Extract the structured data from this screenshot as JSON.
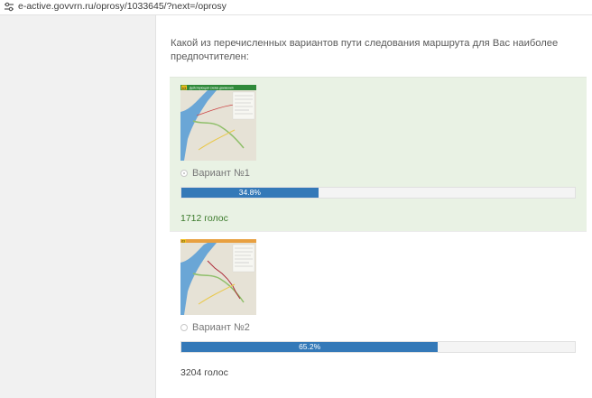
{
  "browser": {
    "url": "e-active.govvrn.ru/oprosy/1033645/?next=/oprosy",
    "url_icon": "tune-icon"
  },
  "poll": {
    "question": "Какой из перечисленных вариантов пути следования маршрута для Вас наиболее предпочтителен:",
    "options": [
      {
        "label": "Вариант №1",
        "percent_label": "34.8%",
        "percent": 34.8,
        "votes": "1712 голос",
        "selected": true,
        "map_header": "Действующая схема движения",
        "map_badge": "63"
      },
      {
        "label": "Вариант №2",
        "percent_label": "65.2%",
        "percent": 65.2,
        "votes": "3204 голос",
        "selected": false,
        "map_header": "",
        "map_badge": "63"
      }
    ]
  },
  "colors": {
    "accent": "#3479b8",
    "selected_bg": "#e9f2e4",
    "votes_green": "#3b7a2b"
  }
}
